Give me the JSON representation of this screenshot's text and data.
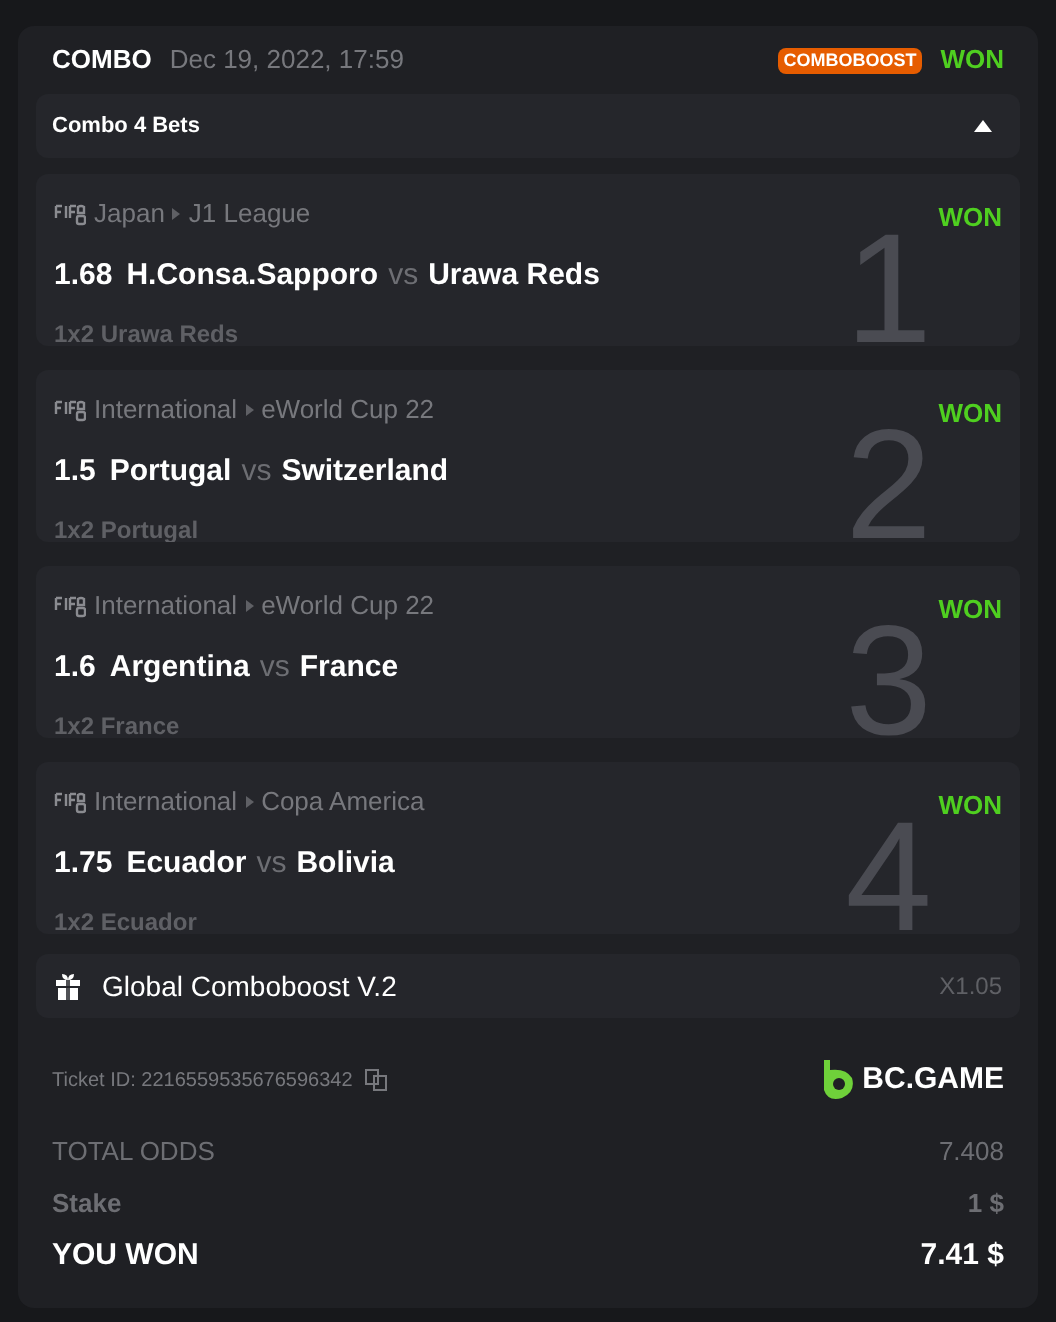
{
  "header": {
    "type": "COMBO",
    "date": "Dec 19, 2022, 17:59",
    "badge": "COMBOBOOST",
    "status": "WON"
  },
  "combo_toggle": {
    "label": "Combo 4 Bets",
    "expanded": true
  },
  "bets": [
    {
      "country": "Japan",
      "league": "J1 League",
      "status": "WON",
      "odds": "1.68",
      "home": "H.Consa.Sapporo",
      "vs": "vs",
      "away": "Urawa Reds",
      "market": "1x2 Urawa Reds",
      "number": "1"
    },
    {
      "country": "International",
      "league": "eWorld Cup 22",
      "status": "WON",
      "odds": "1.5",
      "home": "Portugal",
      "vs": "vs",
      "away": "Switzerland",
      "market": "1x2 Portugal",
      "number": "2"
    },
    {
      "country": "International",
      "league": "eWorld Cup 22",
      "status": "WON",
      "odds": "1.6",
      "home": "Argentina",
      "vs": "vs",
      "away": "France",
      "market": "1x2 France",
      "number": "3"
    },
    {
      "country": "International",
      "league": "Copa America",
      "status": "WON",
      "odds": "1.75",
      "home": "Ecuador",
      "vs": "vs",
      "away": "Bolivia",
      "market": "1x2 Ecuador",
      "number": "4"
    }
  ],
  "boost": {
    "label": "Global Comboboost V.2",
    "multiplier": "X1.05"
  },
  "ticket": {
    "label": "Ticket ID: 2216559535676596342",
    "brand": "BC.GAME"
  },
  "totals": [
    {
      "kind": "muted",
      "label": "TOTAL ODDS",
      "value": "7.408"
    },
    {
      "kind": "semibold",
      "label": "Stake",
      "value": "1 $"
    },
    {
      "kind": "strong",
      "label": "YOU WON",
      "value": "7.41 $"
    }
  ]
}
